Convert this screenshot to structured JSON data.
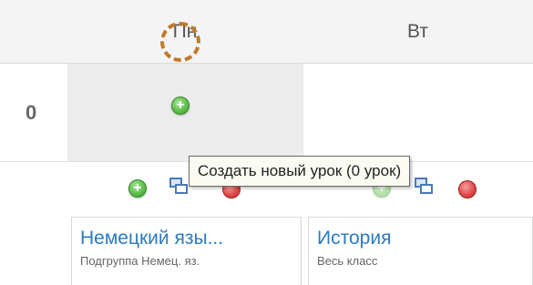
{
  "schedule": {
    "days": [
      "Пн",
      "Вт"
    ],
    "rows": [
      {
        "number": "0"
      }
    ]
  },
  "actions": {
    "add_icon": "plus-circle-icon",
    "copy_icon": "copy-icon",
    "delete_icon": "delete-circle-icon"
  },
  "tooltip": {
    "text": "Создать новый урок (0 урок)"
  },
  "lessons": [
    {
      "title": "Немецкий язы...",
      "subtitle": "Подгруппа Немец. яз."
    },
    {
      "title": "История",
      "subtitle": "Весь класс"
    }
  ],
  "colors": {
    "accent_link": "#2a7ac0",
    "highlight_ring": "#c07a2a",
    "add_green": "#5cbf4a",
    "delete_red": "#e04a4a"
  }
}
